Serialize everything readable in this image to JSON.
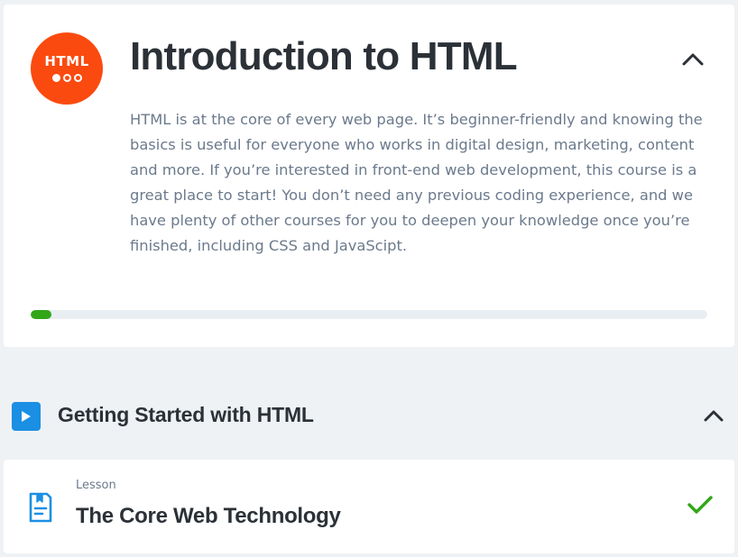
{
  "course": {
    "badge_text": "HTML",
    "title": "Introduction to HTML",
    "description": "HTML is at the core of every web page. It’s beginner-friendly and knowing the basics is useful for everyone who works in digital design, marketing, content and more. If you’re interested in front-end web development, this course is a great place to start! You don’t need any previous coding experience, and we have plenty of other courses for you to deepen your knowledge once you’re finished, including CSS and JavaScipt.",
    "progress_fraction": 0.03,
    "collapse_icon": "chevron-up-icon"
  },
  "section": {
    "icon": "play-icon",
    "title": "Getting Started with HTML",
    "collapse_icon": "chevron-up-icon"
  },
  "lesson": {
    "icon": "lesson-document-icon",
    "type_label": "Lesson",
    "title": "The Core Web Technology",
    "status_icon": "checkmark-icon",
    "completed": true
  },
  "colors": {
    "background": "#eff2f5",
    "badge": "#fb4a0f",
    "progress_fill": "#32a619",
    "progress_track": "#e9eef2",
    "accent_blue": "#1a8fe3",
    "check_green": "#32a619",
    "title_text": "#2b3137",
    "muted_text": "#6b7a8c"
  }
}
